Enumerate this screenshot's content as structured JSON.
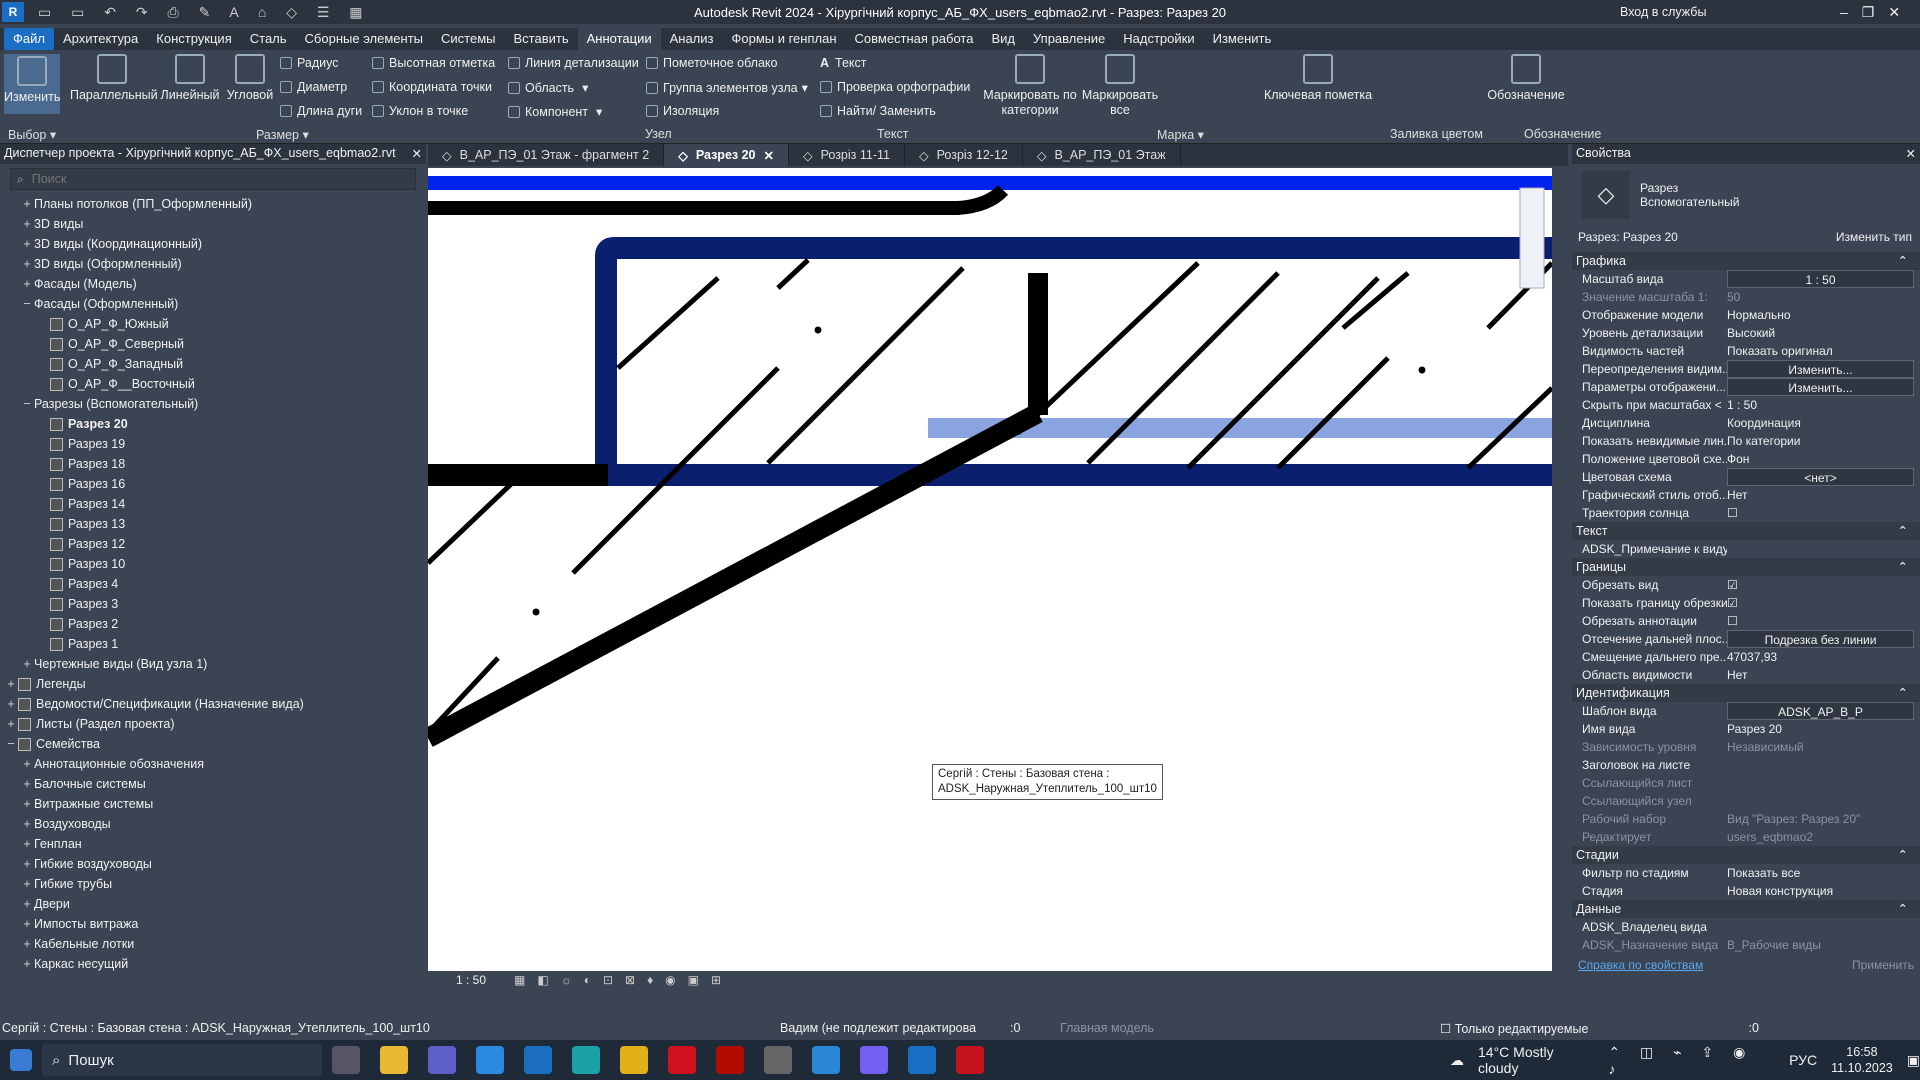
{
  "titlebar": {
    "title": "Autodesk Revit 2024 - Хірургічний корпус_АБ_ФХ_users_eqbmao2.rvt - Разрез: Разрез 20",
    "signin": "Вход в службы"
  },
  "menu": [
    "Файл",
    "Архитектура",
    "Конструкция",
    "Сталь",
    "Сборные элементы",
    "Системы",
    "Вставить",
    "Аннотации",
    "Анализ",
    "Формы и генплан",
    "Совместная работа",
    "Вид",
    "Управление",
    "Надстройки",
    "Изменить"
  ],
  "ribbon": {
    "modify": "Изменить",
    "parallel": "Параллельный",
    "linear": "Линейный",
    "angular": "Угловой",
    "radius": "Радиус",
    "diameter": "Диаметр",
    "arc_length": "Длина дуги",
    "spot_elev": "Высотная отметка",
    "spot_coord": "Координата точки",
    "spot_slope": "Уклон  в точке",
    "detail_line": "Линия детализации",
    "region": "Область",
    "component": "Компонент",
    "revision_cloud": "Пометочное облако",
    "detail_group": "Группа элементов узла",
    "insulation": "Изоляция",
    "text": "Текст",
    "spell": "Проверка  орфографии",
    "find_replace": "Найти/ Заменить",
    "tag_cat": "Маркировать по категории",
    "tag_all": "Маркировать все",
    "keynote": "Ключевая пометка",
    "symbol": "Обозначение",
    "panels": {
      "select": "Выбор",
      "dimension": "Размер",
      "detail": "Узел",
      "text": "Текст",
      "tag": "Марка",
      "fill": "Заливка цветом",
      "symbol": "Обозначение"
    }
  },
  "browser": {
    "title": "Диспетчер проекта - Хірургічний корпус_АБ_ФХ_users_eqbmao2.rvt",
    "search_placeholder": "Поиск",
    "nodes": [
      {
        "lvl": 1,
        "exp": "+",
        "label": "Планы потолков (ПП_Оформленный)"
      },
      {
        "lvl": 1,
        "exp": "+",
        "label": "3D виды"
      },
      {
        "lvl": 1,
        "exp": "+",
        "label": "3D виды (Координационный)"
      },
      {
        "lvl": 1,
        "exp": "+",
        "label": "3D виды (Оформленный)"
      },
      {
        "lvl": 1,
        "exp": "+",
        "label": "Фасады (Модель)"
      },
      {
        "lvl": 1,
        "exp": "−",
        "label": "Фасады (Оформленный)"
      },
      {
        "lvl": 2,
        "label": "О_АР_Ф_Южный"
      },
      {
        "lvl": 2,
        "label": "О_АР_Ф_Северный"
      },
      {
        "lvl": 2,
        "label": "О_АР_Ф_Западный"
      },
      {
        "lvl": 2,
        "label": "О_АР_Ф__Восточный"
      },
      {
        "lvl": 1,
        "exp": "−",
        "label": "Разрезы (Вспомогательный)"
      },
      {
        "lvl": 2,
        "label": "Разрез 20",
        "bold": true
      },
      {
        "lvl": 2,
        "label": "Разрез 19"
      },
      {
        "lvl": 2,
        "label": "Разрез 18"
      },
      {
        "lvl": 2,
        "label": "Разрез 16"
      },
      {
        "lvl": 2,
        "label": "Разрез 14"
      },
      {
        "lvl": 2,
        "label": "Разрез 13"
      },
      {
        "lvl": 2,
        "label": "Разрез 12"
      },
      {
        "lvl": 2,
        "label": "Разрез 10"
      },
      {
        "lvl": 2,
        "label": "Разрез 4"
      },
      {
        "lvl": 2,
        "label": "Разрез 3"
      },
      {
        "lvl": 2,
        "label": "Разрез 2"
      },
      {
        "lvl": 2,
        "label": "Разрез 1"
      },
      {
        "lvl": 1,
        "exp": "+",
        "label": "Чертежные виды (Вид узла 1)"
      },
      {
        "lvl": 0,
        "exp": "+",
        "label": "Легенды",
        "icon": true
      },
      {
        "lvl": 0,
        "exp": "+",
        "label": "Ведомости/Спецификации (Назначение вида)",
        "icon": true
      },
      {
        "lvl": 0,
        "exp": "+",
        "label": "Листы (Раздел проекта)",
        "icon": true
      },
      {
        "lvl": 0,
        "exp": "−",
        "label": "Семейства",
        "icon": true
      },
      {
        "lvl": 1,
        "exp": "+",
        "label": "Аннотационные обозначения"
      },
      {
        "lvl": 1,
        "exp": "+",
        "label": "Балочные системы"
      },
      {
        "lvl": 1,
        "exp": "+",
        "label": "Витражные системы"
      },
      {
        "lvl": 1,
        "exp": "+",
        "label": "Воздуховоды"
      },
      {
        "lvl": 1,
        "exp": "+",
        "label": "Генплан"
      },
      {
        "lvl": 1,
        "exp": "+",
        "label": "Гибкие воздуховоды"
      },
      {
        "lvl": 1,
        "exp": "+",
        "label": "Гибкие трубы"
      },
      {
        "lvl": 1,
        "exp": "+",
        "label": "Двери"
      },
      {
        "lvl": 1,
        "exp": "+",
        "label": "Импосты витража"
      },
      {
        "lvl": 1,
        "exp": "+",
        "label": "Кабельные лотки"
      },
      {
        "lvl": 1,
        "exp": "+",
        "label": "Каркас несущий"
      }
    ]
  },
  "tabs": [
    {
      "label": "В_АР_ПЭ_01 Этаж - фрагмент 2",
      "active": false
    },
    {
      "label": "Разрез 20",
      "active": true
    },
    {
      "label": "Розріз 11-11",
      "active": false
    },
    {
      "label": "Розріз 12-12",
      "active": false
    },
    {
      "label": "В_АР_ПЭ_01 Этаж",
      "active": false
    }
  ],
  "tooltip": {
    "line1": "Сергій : Стены : Базовая стена :",
    "line2": "ADSK_Наружная_Утеплитель_100_шт10"
  },
  "viewbar": {
    "scale": "1 : 50"
  },
  "props": {
    "title": "Свойства",
    "type_name": "Разрез",
    "type_sub": "Вспомогательный",
    "instance": "Разрез: Разрез 20",
    "edit_type": "Изменить тип",
    "sections": [
      {
        "name": "Графика",
        "rows": [
          {
            "k": "Масштаб вида",
            "v": "1 : 50",
            "box": true
          },
          {
            "k": "Значение масштаба   1:",
            "v": "50",
            "dim": true
          },
          {
            "k": "Отображение модели",
            "v": "Нормально"
          },
          {
            "k": "Уровень детализации",
            "v": "Высокий"
          },
          {
            "k": "Видимость частей",
            "v": "Показать оригинал"
          },
          {
            "k": "Переопределения видим...",
            "v": "Изменить...",
            "box": true
          },
          {
            "k": "Параметры отображени...",
            "v": "Изменить...",
            "box": true
          },
          {
            "k": "Скрыть при масштабах <",
            "v": "1 : 50"
          },
          {
            "k": "Дисциплина",
            "v": "Координация"
          },
          {
            "k": "Показать невидимые лин...",
            "v": "По категории"
          },
          {
            "k": "Положение цветовой схе...",
            "v": "Фон"
          },
          {
            "k": "Цветовая схема",
            "v": "<нет>",
            "box": true
          },
          {
            "k": "Графический стиль отоб...",
            "v": "Нет"
          },
          {
            "k": "Траектория солнца",
            "v": "☐"
          }
        ]
      },
      {
        "name": "Текст",
        "rows": [
          {
            "k": "ADSK_Примечание к виду",
            "v": ""
          }
        ]
      },
      {
        "name": "Границы",
        "rows": [
          {
            "k": "Обрезать вид",
            "v": "☑"
          },
          {
            "k": "Показать границу обрезки",
            "v": "☑"
          },
          {
            "k": "Обрезать аннотации",
            "v": "☐"
          },
          {
            "k": "Отсечение дальней плос...",
            "v": "Подрезка без линии",
            "box": true
          },
          {
            "k": "Смещение дальнего пре...",
            "v": "47037,93"
          },
          {
            "k": "Область видимости",
            "v": "Нет"
          }
        ]
      },
      {
        "name": "Идентификация",
        "rows": [
          {
            "k": "Шаблон вида",
            "v": "ADSK_АР_В_Р",
            "box": true
          },
          {
            "k": "Имя вида",
            "v": "Разрез 20"
          },
          {
            "k": "Зависимость уровня",
            "v": "Независимый",
            "dim": true
          },
          {
            "k": "Заголовок на листе",
            "v": ""
          },
          {
            "k": "Ссылающийся лист",
            "v": "",
            "dim": true
          },
          {
            "k": "Ссылающийся узел",
            "v": "",
            "dim": true
          },
          {
            "k": "Рабочий набор",
            "v": "Вид \"Разрез: Разрез 20\"",
            "dim": true
          },
          {
            "k": "Редактирует",
            "v": "users_eqbmao2",
            "dim": true
          }
        ]
      },
      {
        "name": "Стадии",
        "rows": [
          {
            "k": "Фильтр по стадиям",
            "v": "Показать все"
          },
          {
            "k": "Стадия",
            "v": "Новая конструкция"
          }
        ]
      },
      {
        "name": "Данные",
        "rows": [
          {
            "k": "ADSK_Владелец вида",
            "v": ""
          },
          {
            "k": "ADSK_Назначение вида",
            "v": "В_Рабочие виды",
            "dim": true
          }
        ]
      }
    ],
    "help": "Справка по свойствам",
    "apply": "Применить"
  },
  "status": {
    "text": "Сергій : Стены : Базовая стена : ADSK_Наружная_Утеплитель_100_шт10",
    "workset": "Вадим (не подлежит редактирова",
    "count": ":0",
    "model": "Главная модель",
    "editable_only": "Только редактируемые",
    "filter_count": ":0"
  },
  "taskbar": {
    "search": "Пошук",
    "weather": "14°C  Mostly cloudy",
    "lang": "РУС",
    "time": "16:58",
    "date": "11.10.2023"
  },
  "colors": {
    "accent": "#1a6fc4",
    "wall_blue": "#0a1f6e",
    "bright_blue": "#0022ee",
    "light_blue": "#8aa4e0"
  }
}
